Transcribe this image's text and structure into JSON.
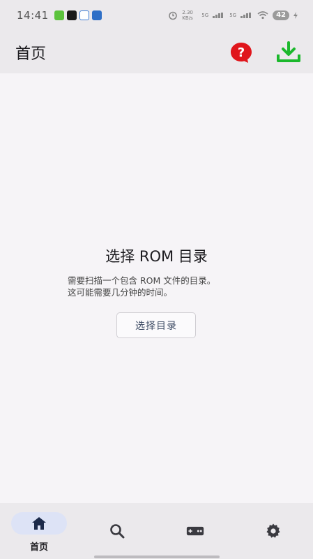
{
  "status_bar": {
    "time": "14:41",
    "battery": "42",
    "network_speed": "2.30 KB/s",
    "signal1": "5G",
    "signal2": "5G"
  },
  "app_bar": {
    "title": "首页",
    "help_icon": "help-icon",
    "download_icon": "download-icon",
    "help_color": "#e0161c",
    "download_color": "#1bb82c"
  },
  "main": {
    "empty_title": "选择 ROM 目录",
    "empty_desc_line1": "需要扫描一个包含 ROM 文件的目录。",
    "empty_desc_line2": "这可能需要几分钟的时间。",
    "select_button": "选择目录"
  },
  "bottom_nav": {
    "items": [
      {
        "label": "首页",
        "icon": "home-icon",
        "active": true
      },
      {
        "label": "",
        "icon": "search-icon",
        "active": false
      },
      {
        "label": "",
        "icon": "gamepad-icon",
        "active": false
      },
      {
        "label": "",
        "icon": "gear-icon",
        "active": false
      }
    ]
  },
  "colors": {
    "background": "#f6f4f7",
    "bar_background": "#ebe9ec",
    "active_pill": "#dde3f6"
  }
}
